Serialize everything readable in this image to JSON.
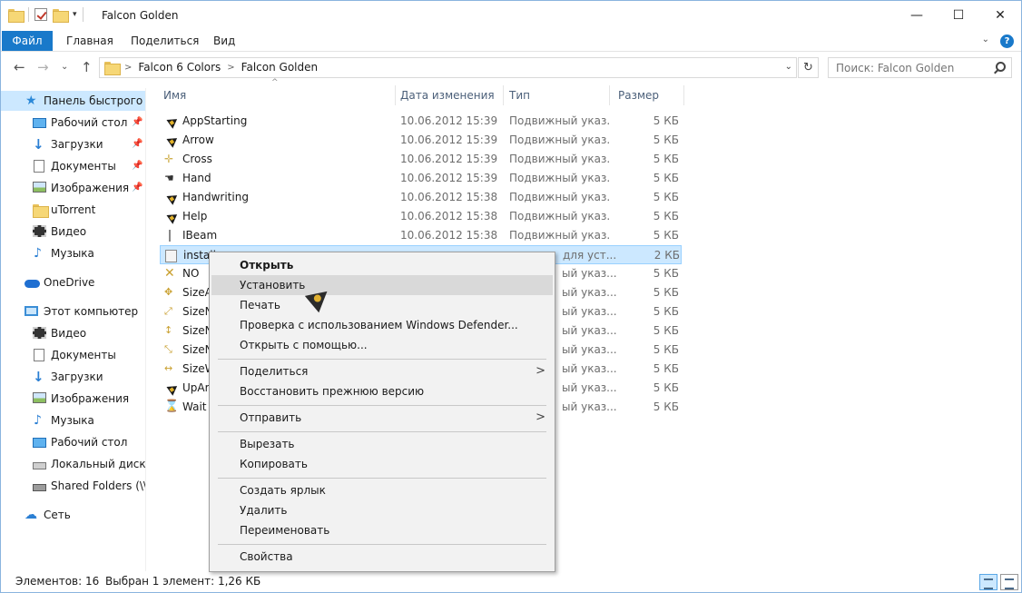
{
  "window": {
    "title": "Falcon Golden",
    "minimize": "—",
    "maximize": "☐",
    "close": "✕"
  },
  "quick_access_toolbar": {
    "dropdown": "▾"
  },
  "ribbon": {
    "tabs": [
      "Файл",
      "Главная",
      "Поделиться",
      "Вид"
    ],
    "collapse_arrow": "⌄",
    "help": "?"
  },
  "nav": {
    "back": "←",
    "forward": "→",
    "recent": "⌄",
    "up": "↑",
    "breadcrumbs": [
      "Falcon 6 Colors",
      "Falcon Golden"
    ],
    "breadcrumb_sep": ">",
    "address_dropdown": "⌄",
    "refresh": "↻",
    "search_placeholder": "Поиск: Falcon Golden"
  },
  "sidebar": {
    "pin": "📌",
    "items": [
      {
        "label": "Панель быстрого доступа",
        "icon": "star-icon",
        "selected": true
      },
      {
        "label": "Рабочий стол",
        "icon": "desktop-icon",
        "pinned": true
      },
      {
        "label": "Загрузки",
        "icon": "downloads-icon",
        "pinned": true
      },
      {
        "label": "Документы",
        "icon": "documents-icon",
        "pinned": true
      },
      {
        "label": "Изображения",
        "icon": "pictures-icon",
        "pinned": true
      },
      {
        "label": "uTorrent",
        "icon": "folder-icon"
      },
      {
        "label": "Видео",
        "icon": "video-icon"
      },
      {
        "label": "Музыка",
        "icon": "music-icon"
      },
      {
        "label": "OneDrive",
        "icon": "onedrive-icon"
      },
      {
        "label": "Этот компьютер",
        "icon": "computer-icon"
      },
      {
        "label": "Видео",
        "icon": "video-icon"
      },
      {
        "label": "Документы",
        "icon": "documents-icon"
      },
      {
        "label": "Загрузки",
        "icon": "downloads-icon"
      },
      {
        "label": "Изображения",
        "icon": "pictures-icon"
      },
      {
        "label": "Музыка",
        "icon": "music-icon"
      },
      {
        "label": "Рабочий стол",
        "icon": "desktop-icon"
      },
      {
        "label": "Локальный диск (C:)",
        "icon": "local-disk-icon"
      },
      {
        "label": "Shared Folders (\\\\vmware-host) (Z:)",
        "icon": "network-drive-icon"
      },
      {
        "label": "Сеть",
        "icon": "network-icon"
      }
    ]
  },
  "list": {
    "sort_indicator": "^",
    "columns": [
      "Имя",
      "Дата изменения",
      "Тип",
      "Размер"
    ],
    "rows": [
      {
        "name": "AppStarting",
        "date": "10.06.2012 15:39",
        "type": "Подвижный указ...",
        "size": "5 КБ",
        "icon": "cursor-arrow-icon"
      },
      {
        "name": "Arrow",
        "date": "10.06.2012 15:39",
        "type": "Подвижный указ...",
        "size": "5 КБ",
        "icon": "cursor-arrow-icon"
      },
      {
        "name": "Cross",
        "date": "10.06.2012 15:39",
        "type": "Подвижный указ...",
        "size": "5 КБ",
        "icon": "cursor-cross-icon"
      },
      {
        "name": "Hand",
        "date": "10.06.2012 15:39",
        "type": "Подвижный указ...",
        "size": "5 КБ",
        "icon": "cursor-hand-icon"
      },
      {
        "name": "Handwriting",
        "date": "10.06.2012 15:38",
        "type": "Подвижный указ...",
        "size": "5 КБ",
        "icon": "cursor-arrow-icon"
      },
      {
        "name": "Help",
        "date": "10.06.2012 15:38",
        "type": "Подвижный указ...",
        "size": "5 КБ",
        "icon": "cursor-arrow-icon"
      },
      {
        "name": "IBeam",
        "date": "10.06.2012 15:38",
        "type": "Подвижный указ...",
        "size": "5 КБ",
        "icon": "cursor-ibeam-icon"
      },
      {
        "name": "install",
        "date": "",
        "type": "для уст...",
        "size": "2 КБ",
        "icon": "setup-info-icon",
        "selected": true
      },
      {
        "name": "NO",
        "date": "",
        "type": "ый указ...",
        "size": "5 КБ",
        "icon": "cursor-no-icon"
      },
      {
        "name": "SizeAll",
        "date": "",
        "type": "ый указ...",
        "size": "5 КБ",
        "icon": "cursor-size-icon"
      },
      {
        "name": "SizeNESW",
        "date": "",
        "type": "ый указ...",
        "size": "5 КБ",
        "icon": "cursor-size-icon"
      },
      {
        "name": "SizeNS",
        "date": "",
        "type": "ый указ...",
        "size": "5 КБ",
        "icon": "cursor-size-icon"
      },
      {
        "name": "SizeNWSE",
        "date": "",
        "type": "ый указ...",
        "size": "5 КБ",
        "icon": "cursor-size-icon"
      },
      {
        "name": "SizeWE",
        "date": "",
        "type": "ый указ...",
        "size": "5 КБ",
        "icon": "cursor-size-icon"
      },
      {
        "name": "UpArrow",
        "date": "",
        "type": "ый указ...",
        "size": "5 КБ",
        "icon": "cursor-arrow-icon"
      },
      {
        "name": "Wait",
        "date": "",
        "type": "ый указ...",
        "size": "5 КБ",
        "icon": "cursor-wait-icon"
      }
    ]
  },
  "context_menu": {
    "submenu_arrow": ">",
    "items": [
      {
        "label": "Открыть",
        "bold": true
      },
      {
        "label": "Установить",
        "hover": true
      },
      {
        "label": "Печать"
      },
      {
        "label": "Проверка с использованием Windows Defender..."
      },
      {
        "label": "Открыть с помощью..."
      },
      {
        "label": "Поделиться",
        "submenu": true
      },
      {
        "label": "Восстановить прежнюю версию"
      },
      {
        "label": "Отправить",
        "submenu": true
      },
      {
        "label": "Вырезать"
      },
      {
        "label": "Копировать"
      },
      {
        "label": "Создать ярлык"
      },
      {
        "label": "Удалить"
      },
      {
        "label": "Переименовать"
      },
      {
        "label": "Свойства"
      }
    ]
  },
  "status": {
    "count": "Элементов: 16",
    "selection": "Выбран 1 элемент: 1,26 КБ"
  }
}
